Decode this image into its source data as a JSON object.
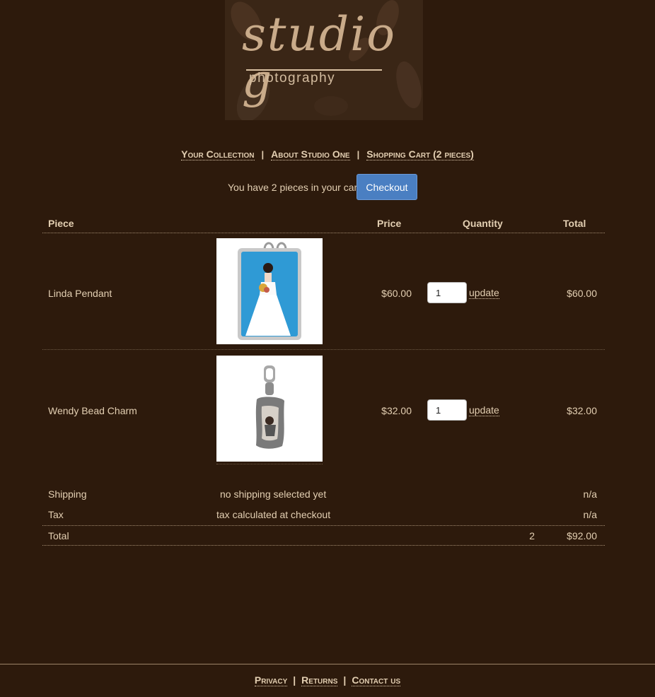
{
  "logo": {
    "script": "studio g",
    "sub": "photography"
  },
  "nav": {
    "items": [
      "Your Collection",
      "About Studio One",
      "Shopping Cart (2 pieces)"
    ],
    "separator": "|"
  },
  "cart_summary": {
    "text": "You have 2 pieces in your cart.",
    "checkout_label": "Checkout"
  },
  "table": {
    "headers": {
      "piece": "Piece",
      "price": "Price",
      "quantity": "Quantity",
      "total": "Total"
    },
    "rows": [
      {
        "name": "Linda Pendant",
        "price": "$60.00",
        "qty": "1",
        "update": "update",
        "total": "$60.00"
      },
      {
        "name": "Wendy Bead Charm",
        "price": "$32.00",
        "qty": "1",
        "update": "update",
        "total": "$32.00"
      }
    ],
    "shipping": {
      "label": "Shipping",
      "note": "no shipping selected yet",
      "value": "n/a"
    },
    "tax": {
      "label": "Tax",
      "note": "tax calculated at checkout",
      "value": "n/a"
    },
    "grand_total": {
      "label": "Total",
      "count": "2",
      "value": "$92.00"
    }
  },
  "footer": {
    "items": [
      "Privacy",
      "Returns",
      "Contact us"
    ],
    "separator": "|"
  },
  "colors": {
    "background": "#2d1a0c",
    "text": "#e3cfb2",
    "button": "#4a7fc2"
  }
}
